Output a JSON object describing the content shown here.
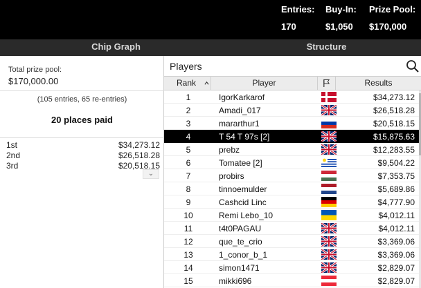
{
  "header": {
    "entries_label": "Entries:",
    "entries_value": "170",
    "buyin_label": "Buy-In:",
    "buyin_value": "$1,050",
    "prize_label": "Prize Pool:",
    "prize_value": "$170,000"
  },
  "tabs": {
    "chip_graph": "Chip Graph",
    "structure": "Structure"
  },
  "left": {
    "total_prize_label": "Total prize pool:",
    "total_prize_value": "$170,000.00",
    "entries_note": "(105 entries, 65 re-entries)",
    "places_paid": "20 places paid",
    "payouts": [
      {
        "place": "1st",
        "amount": "$34,273.12"
      },
      {
        "place": "2nd",
        "amount": "$26,518.28"
      },
      {
        "place": "3rd",
        "amount": "$20,518.15"
      }
    ],
    "more_icon": "chevron-down-icon"
  },
  "players": {
    "title": "Players",
    "search_icon": "search-icon",
    "columns": {
      "rank": "Rank",
      "player": "Player",
      "flag_icon": "flag-icon",
      "results": "Results"
    },
    "rows": [
      {
        "rank": "1",
        "player": "IgorKarkarof",
        "flag": "denmark",
        "result": "$34,273.12"
      },
      {
        "rank": "2",
        "player": "Amadi_017",
        "flag": "uk",
        "result": "$26,518.28"
      },
      {
        "rank": "3",
        "player": "mararthur1",
        "flag": "russia",
        "result": "$20,518.15"
      },
      {
        "rank": "4",
        "player": "T 54 T 97s [2]",
        "flag": "uk",
        "result": "$15,875.63",
        "highlighted": true
      },
      {
        "rank": "5",
        "player": "prebz",
        "flag": "uk",
        "result": "$12,283.55"
      },
      {
        "rank": "6",
        "player": "Tomatee [2]",
        "flag": "uruguay",
        "result": "$9,504.22"
      },
      {
        "rank": "7",
        "player": "probirs",
        "flag": "hungary",
        "result": "$7,353.75"
      },
      {
        "rank": "8",
        "player": "tinnoemulder",
        "flag": "netherlands",
        "result": "$5,689.86"
      },
      {
        "rank": "9",
        "player": "Cashcid Linc",
        "flag": "germany",
        "result": "$4,777.90"
      },
      {
        "rank": "10",
        "player": "Remi Lebo_10",
        "flag": "ukraine",
        "result": "$4,012.11"
      },
      {
        "rank": "11",
        "player": "t4t0PAGAU",
        "flag": "uk",
        "result": "$4,012.11"
      },
      {
        "rank": "12",
        "player": "que_te_crio",
        "flag": "uk",
        "result": "$3,369.06"
      },
      {
        "rank": "13",
        "player": "1_conor_b_1",
        "flag": "uk",
        "result": "$3,369.06"
      },
      {
        "rank": "14",
        "player": "simon1471",
        "flag": "uk",
        "result": "$2,829.07"
      },
      {
        "rank": "15",
        "player": "mikki696",
        "flag": "austria",
        "result": "$2,829.07"
      }
    ]
  },
  "colors": {
    "header_bg": "#000000",
    "tab_bg": "#2a2a2a",
    "highlight_bg": "#000000"
  }
}
